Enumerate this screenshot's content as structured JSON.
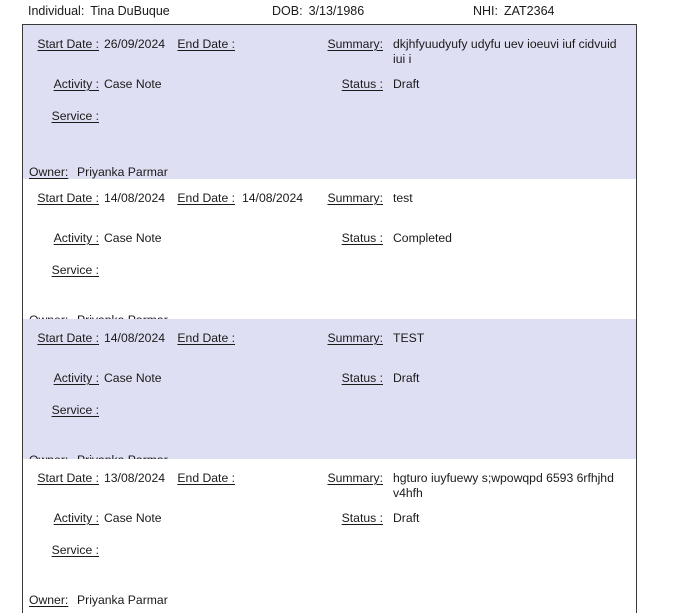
{
  "header": {
    "individual_label": "Individual:",
    "individual_value": "Tina DuBuque",
    "dob_label": "DOB:",
    "dob_value": "3/13/1986",
    "nhi_label": "NHI:",
    "nhi_value": "ZAT2364"
  },
  "labels": {
    "start_date": "Start Date :",
    "end_date": "End Date :",
    "summary": "Summary:",
    "activity": "Activity :",
    "status": "Status :",
    "service": "Service :",
    "owner": "Owner:"
  },
  "colors": {
    "row_highlight": "#dfdff3",
    "row_plain": "#ffffff",
    "border": "#3a3a3a",
    "text": "#1a1a1a"
  },
  "records": [
    {
      "start_date": "26/09/2024",
      "end_date": "",
      "summary": "dkjhfyuudyufy udyfu uev ioeuvi iuf cidvuid iui i",
      "activity": "Case Note",
      "status": "Draft",
      "service": "",
      "owner": "Priyanka Parmar",
      "highlighted": true
    },
    {
      "start_date": "14/08/2024",
      "end_date": "14/08/2024",
      "summary": "test",
      "activity": "Case Note",
      "status": "Completed",
      "service": "",
      "owner": "Priyanka Parmar",
      "highlighted": false
    },
    {
      "start_date": "14/08/2024",
      "end_date": "",
      "summary": "TEST",
      "activity": "Case Note",
      "status": "Draft",
      "service": "",
      "owner": "Priyanka Parmar",
      "highlighted": true
    },
    {
      "start_date": "13/08/2024",
      "end_date": "",
      "summary": "hgturo iuyfuewy s;wpowqpd 6593 6rfhjhd v4hfh",
      "activity": "Case Note",
      "status": "Draft",
      "service": "",
      "owner": "Priyanka Parmar",
      "highlighted": false
    }
  ]
}
